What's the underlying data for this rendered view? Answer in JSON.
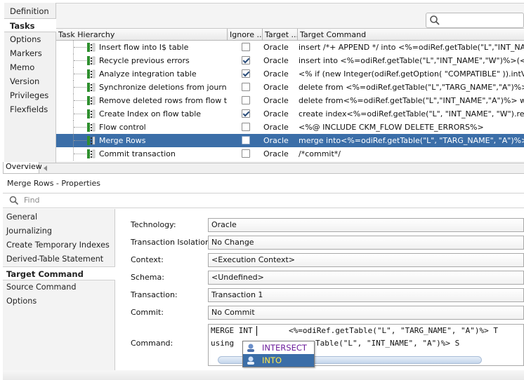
{
  "left_tabs": [
    "Definition",
    "Tasks",
    "Options",
    "Markers",
    "Memo",
    "Version",
    "Privileges",
    "Flexfields"
  ],
  "left_tab_selected": "Tasks",
  "grid": {
    "columns": [
      "Task Hierarchy",
      "Ignore ...",
      "Target ...",
      "Target Command"
    ],
    "rows": [
      {
        "name": "Insert flow into I$ table",
        "ignore": false,
        "target": "Oracle",
        "command": "insert /*+ APPEND */  into <%=odiRef.getTable(\"L\",\"INT_NAME\""
      },
      {
        "name": "Recycle previous errors",
        "ignore": true,
        "target": "Oracle",
        "command": "insert into <%=odiRef.getTable(\"L\",\"INT_NAME\",\"W\")%>(<%="
      },
      {
        "name": "Analyze integration table",
        "ignore": true,
        "target": "Oracle",
        "command": "<% if (new Integer(odiRef.getOption( \"COMPATIBLE\" )).intValue"
      },
      {
        "name": "Synchronize deletions from journal",
        "ignore": false,
        "target": "Oracle",
        "command": "delete from <%=odiRef.getTable(\"L\",\"TARG_NAME\",\"A\")%> whe"
      },
      {
        "name": "Remove deleted rows from flow table",
        "ignore": false,
        "target": "Oracle",
        "command": "delete from<%=odiRef.getTable(\"L\",\"INT_NAME\",\"A\")%> where"
      },
      {
        "name": "Create Index on flow table",
        "ignore": true,
        "target": "Oracle",
        "command": "create index<%=odiRef.getTable(\"L\", \"INT_NAME\", \"W\").replac"
      },
      {
        "name": "Flow control",
        "ignore": false,
        "target": "Oracle",
        "command": "<%@ INCLUDE CKM_FLOW DELETE_ERRORS%>"
      },
      {
        "name": "Merge Rows",
        "ignore": false,
        "target": "Oracle",
        "command": "merge into<%=odiRef.getTable(\"L\", \"TARG_NAME\", \"A\")%> Tus"
      },
      {
        "name": "Commit transaction",
        "ignore": false,
        "target": "Oracle",
        "command": "/*commit*/"
      }
    ],
    "selected_row": "Merge Rows"
  },
  "overview_tab": "Overview",
  "properties": {
    "title": "Merge Rows - Properties",
    "find_placeholder": "Find",
    "nav": [
      "General",
      "Journalizing",
      "Create Temporary Indexes",
      "Derived-Table Statement",
      "Target Command",
      "Source Command",
      "Options"
    ],
    "nav_selected": "Target Command",
    "fields": [
      {
        "label": "Technology:",
        "value": "Oracle"
      },
      {
        "label": "Transaction Isolation:",
        "value": "No Change"
      },
      {
        "label": "Context:",
        "value": "<Execution Context>"
      },
      {
        "label": "Schema:",
        "value": "<Undefined>"
      },
      {
        "label": "Transaction:",
        "value": "Transaction 1"
      },
      {
        "label": "Commit:",
        "value": "No Commit"
      }
    ],
    "command_label": "Command:",
    "command_line1_a": "MERGE INT",
    "command_line1_b": "<%=odiRef.getTable(\"L\", \"TARG_NAME\", \"A\")%> T",
    "command_line2_a": "using",
    "command_line2_b": "Table(\"L\", \"INT_NAME\", \"A\")%> S",
    "autocomplete": [
      "INTERSECT",
      "INTO"
    ],
    "autocomplete_selected": "INTO"
  },
  "colors": {
    "selection": "#3b6ea8",
    "keyword": "#7b1fa2"
  }
}
